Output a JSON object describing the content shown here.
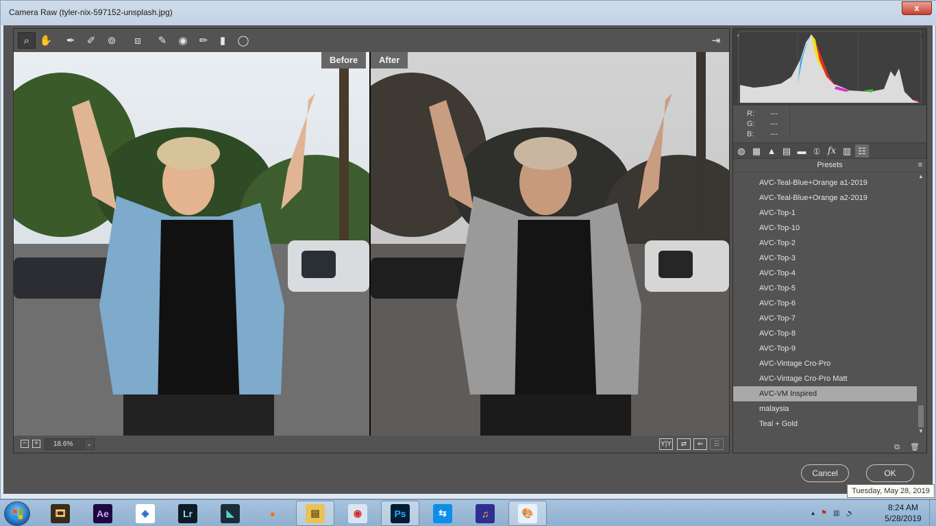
{
  "window": {
    "title": "Camera Raw (tyler-nix-597152-unsplash.jpg)",
    "close_glyph": "x"
  },
  "toolbar": {
    "tools": [
      {
        "icon": "zoom-icon",
        "glyph": "⌕"
      },
      {
        "icon": "hand-icon",
        "glyph": "✋"
      },
      {
        "icon": "white-balance-icon",
        "glyph": "✒"
      },
      {
        "icon": "color-sampler-icon",
        "glyph": "✐"
      },
      {
        "icon": "target-adjustment-icon",
        "glyph": "⊚"
      },
      {
        "icon": "transform-icon",
        "glyph": "⧈"
      },
      {
        "icon": "spot-removal-icon",
        "glyph": "✎"
      },
      {
        "icon": "red-eye-icon",
        "glyph": "◉"
      },
      {
        "icon": "adjustment-brush-icon",
        "glyph": "✏"
      },
      {
        "icon": "graduated-filter-icon",
        "glyph": "▮"
      },
      {
        "icon": "radial-filter-icon",
        "glyph": "◯"
      }
    ],
    "export_icon": "export-icon",
    "export_glyph": "⇥"
  },
  "preview": {
    "before_label": "Before",
    "after_label": "After"
  },
  "bottom_bar": {
    "zoom_out_glyph": "−",
    "zoom_in_glyph": "+",
    "zoom_value": "18.6%",
    "zoom_drop_glyph": "⌄",
    "view_buttons": [
      {
        "icon": "before-after-view-icon",
        "glyph": "Y|Y"
      },
      {
        "icon": "swap-settings-icon",
        "glyph": "⇄"
      },
      {
        "icon": "copy-settings-icon",
        "glyph": "⇐"
      },
      {
        "icon": "toggle-settings-icon",
        "glyph": "☰"
      }
    ]
  },
  "histogram": {
    "shadow_clip_glyph": "▲",
    "highlight_clip_glyph": "▲"
  },
  "rgb_readout": {
    "r_label": "R:",
    "r_value": "---",
    "g_label": "G:",
    "g_value": "---",
    "b_label": "B:",
    "b_value": "---"
  },
  "panel_tabs": [
    {
      "icon": "basic-icon",
      "glyph": "◍"
    },
    {
      "icon": "tone-curve-icon",
      "glyph": "▦"
    },
    {
      "icon": "detail-icon",
      "glyph": "▲"
    },
    {
      "icon": "hsl-icon",
      "glyph": "▤"
    },
    {
      "icon": "split-toning-icon",
      "glyph": "▬"
    },
    {
      "icon": "lens-corrections-icon",
      "glyph": "⦶"
    },
    {
      "icon": "effects-icon",
      "glyph": "fx"
    },
    {
      "icon": "calibration-icon",
      "glyph": "▥"
    },
    {
      "icon": "presets-icon",
      "glyph": "☷"
    }
  ],
  "presets": {
    "header": "Presets",
    "menu_glyph": "≡",
    "items": [
      "AVC-Teal-Blue+Orange a1-2019",
      "AVC-Teal-Blue+Orange a2-2019",
      "AVC-Top-1",
      "AVC-Top-10",
      "AVC-Top-2",
      "AVC-Top-3",
      "AVC-Top-4",
      "AVC-Top-5",
      "AVC-Top-6",
      "AVC-Top-7",
      "AVC-Top-8",
      "AVC-Top-9",
      "AVC-Vintage Cro-Pro",
      "AVC-Vintage Cro-Pro Matt",
      "AVC-VM Inspired",
      "malaysia",
      "Teal + Gold"
    ],
    "selected": "AVC-VM Inspired",
    "scroll_up_glyph": "▲",
    "scroll_down_glyph": "▼",
    "new_preset_glyph": "⧉",
    "delete_glyph": "🗑"
  },
  "dialog": {
    "cancel_label": "Cancel",
    "ok_label": "OK"
  },
  "tooltip": "Tuesday, May 28, 2019",
  "taskbar": {
    "apps": [
      {
        "icon": "video-icon",
        "glyph": "🎞",
        "bg": "#3a2a1a",
        "fg": "#ffd27a",
        "open": false
      },
      {
        "icon": "after-effects-icon",
        "glyph": "Ae",
        "bg": "#1f0740",
        "fg": "#c9a4ff",
        "open": false
      },
      {
        "icon": "app-diamond-icon",
        "glyph": "◈",
        "bg": "#ffffff",
        "fg": "#2a6bc4",
        "open": false
      },
      {
        "icon": "lightroom-icon",
        "glyph": "Lr",
        "bg": "#0c1b26",
        "fg": "#9fd4f5",
        "open": false
      },
      {
        "icon": "filmora-icon",
        "glyph": "◣",
        "bg": "#1b2b3a",
        "fg": "#4fd3c6",
        "open": false
      },
      {
        "icon": "firefox-icon",
        "glyph": "●",
        "bg": "transparent",
        "fg": "#f07321",
        "open": false
      },
      {
        "icon": "file-explorer-icon",
        "glyph": "▤",
        "bg": "#e9c25a",
        "fg": "#6c5412",
        "open": true
      },
      {
        "icon": "screen-recorder-icon",
        "glyph": "◉",
        "bg": "#d9e6f2",
        "fg": "#d32b2b",
        "open": false
      },
      {
        "icon": "photoshop-icon",
        "glyph": "Ps",
        "bg": "#001d34",
        "fg": "#31a8ff",
        "open": true
      },
      {
        "icon": "teamviewer-icon",
        "glyph": "⇆",
        "bg": "#0e8ee9",
        "fg": "#ffffff",
        "open": false
      },
      {
        "icon": "audio-editor-icon",
        "glyph": "♫",
        "bg": "#2f2f8f",
        "fg": "#ffcc33",
        "open": false
      },
      {
        "icon": "paint-icon",
        "glyph": "🎨",
        "bg": "#eaf2fb",
        "fg": "#b5651d",
        "open": true
      }
    ],
    "tray": [
      {
        "icon": "show-hidden-icons-icon",
        "glyph": "▴"
      },
      {
        "icon": "action-center-icon",
        "glyph": "⚑"
      },
      {
        "icon": "network-icon",
        "glyph": "▥"
      },
      {
        "icon": "volume-icon",
        "glyph": "🔈"
      }
    ],
    "time": "8:24 AM",
    "date": "5/28/2019"
  },
  "colors": {
    "panel_bg": "#535353",
    "selected_preset_bg": "#a9a9a9",
    "taskbar": "#9ab8d6"
  }
}
